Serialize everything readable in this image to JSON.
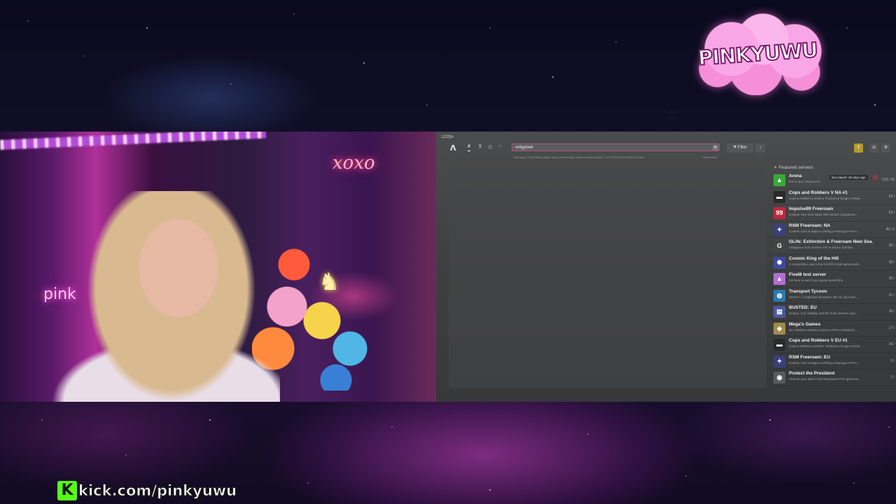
{
  "logo": {
    "text": "PINKYUWU"
  },
  "webcam": {
    "neon_xoxo": "xoxo",
    "neon_pink": "pink"
  },
  "game": {
    "fps": "122fps",
    "brand": "Λ",
    "tabs": [
      "#",
      "$",
      "◷",
      "♡"
    ],
    "search": {
      "value": "onlypixel",
      "hints": "\"rock play\" to find string match,  tag  to match tags,  locale  to match locale,  1.2.3.4:30120  for Direct Connect",
      "cheatsheet": "Cheat sheet"
    },
    "filter_label": "Filter",
    "sort_label": "↕",
    "avatar_letter": "T",
    "featured": {
      "title": "Featured servers",
      "servers": [
        {
          "name": "Arena",
          "desc": "PvP ▸ Gun Game ▸ Ki...",
          "players": "213 / 20",
          "icon": "▲",
          "icon_color": "#3aa83a",
          "last_played": "last played: 28 days ago"
        },
        {
          "name": "Cops and Robbers V NA #1",
          "desc": "Cops ▸ Robbers ▸ EMS ▸ Truckers ▸ Drugs ▸ Redu...",
          "players": "53 /",
          "icon": "▬",
          "icon_color": "#2a2a2a"
        },
        {
          "name": "Impulse99 Freeroam",
          "desc": "Custom cars and maps! 20k various minigames...",
          "players": "63 /",
          "icon": "99",
          "icon_color": "#c0283a"
        },
        {
          "name": "RSM Freeroam: NA",
          "desc": "Custom Cars & Maps ▸ Drifting ▸ Racing ▸ PvP ▸...",
          "players": "45 / 2",
          "icon": "✦",
          "icon_color": "#3b3f7a"
        },
        {
          "name": "GLife: Extinction & Freeroam New Sea...",
          "desc": "Leagues ▸ Gun Game ▸ FFA ▸ Duel ▸ Zombie...",
          "players": "36 /",
          "icon": "G",
          "icon_color": "#444"
        },
        {
          "name": "Cosmic King of the Hill",
          "desc": "A competitive, pvp Arma 3 KOTH style gamemode...",
          "players": "39 /",
          "icon": "✺",
          "icon_color": "#3a4aa0"
        },
        {
          "name": "FiveM test server",
          "desc": "Go here to see if your game works fine",
          "players": "25 /",
          "icon": "▲",
          "icon_color": "#b070d0"
        },
        {
          "name": "Transport Tycoon",
          "desc": "Server 1: A logistical simulator! We sit, land and...",
          "players": "21 /",
          "icon": "◍",
          "icon_color": "#2a7ab0"
        },
        {
          "name": "BUSTED: EU",
          "desc": "Unique, non roleplay and the most intense cops...",
          "players": "16 /",
          "icon": "▤",
          "icon_color": "#4a5a9a"
        },
        {
          "name": "Mega's Games",
          "desc": "40+ Modes ▸ Races ▸ Sumo ▸ PvP ▸ Ranked E...",
          "players": "17 /",
          "icon": "◆",
          "icon_color": "#a08a4a"
        },
        {
          "name": "Cops and Robbers V EU #1",
          "desc": "Cops ▸ Robbers ▸ EMS ▸ Truckers ▸ Drugs ▸ Redu...",
          "players": "16 /",
          "icon": "▬",
          "icon_color": "#2a2a2a"
        },
        {
          "name": "RSM Freeroam: EU",
          "desc": "Custom Cars & Maps ▸ Drifting ▸ Racing ▸ PvP ▸...",
          "players": "3 /",
          "icon": "✦",
          "icon_color": "#3b3f7a"
        },
        {
          "name": "Protect the President",
          "desc": "Choose your side in this fast-paced PVP gamemo...",
          "players": "1 /",
          "icon": "◉",
          "icon_color": "#5a5a5a"
        }
      ]
    }
  },
  "kick": {
    "icon_letter": "K",
    "url": "kick.com/pinkyuwu"
  }
}
